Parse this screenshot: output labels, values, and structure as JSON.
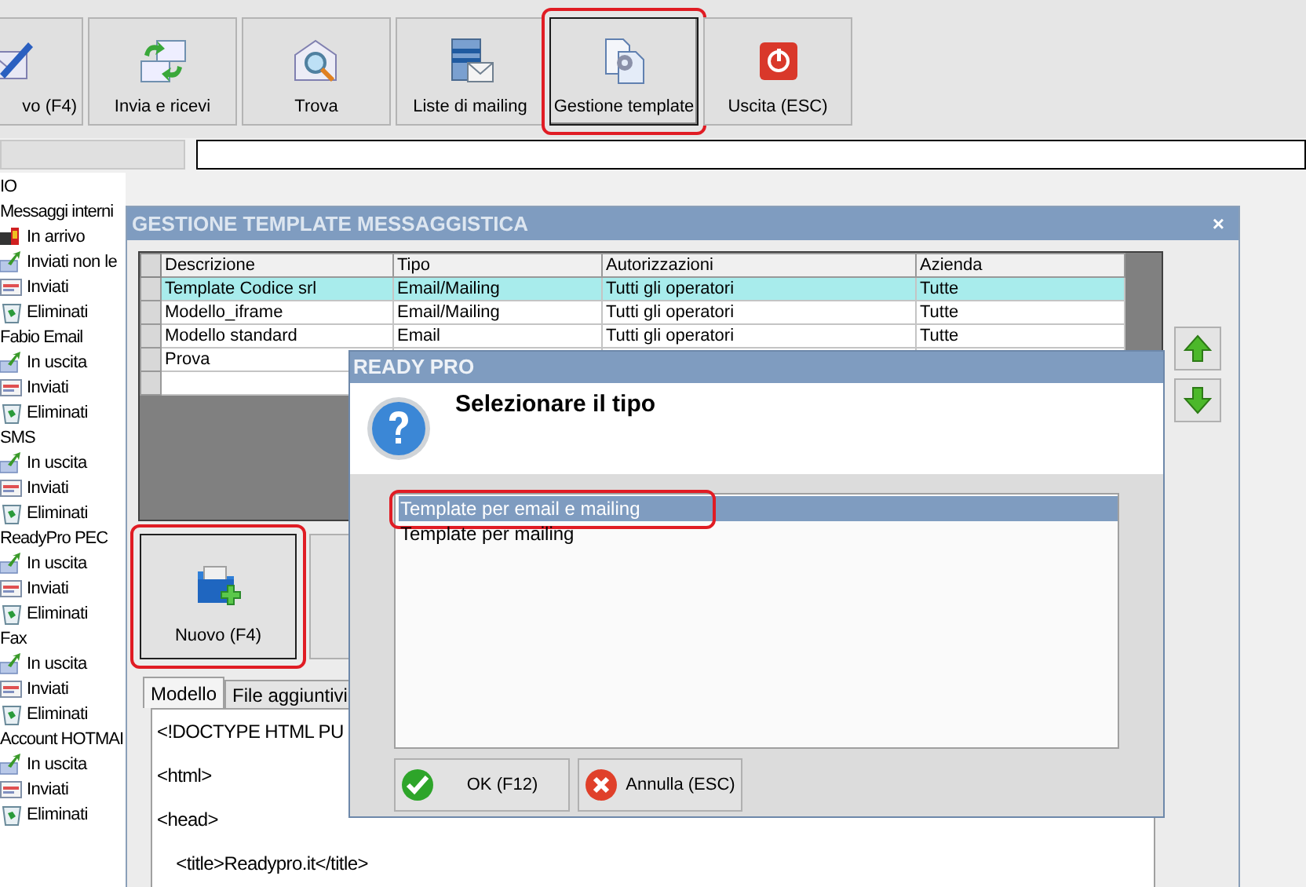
{
  "toolbar": [
    {
      "label": "vo (F4)",
      "kind": "new",
      "selected": false,
      "highlighted": false
    },
    {
      "label": "Invia e ricevi",
      "kind": "sendreceive",
      "selected": false,
      "highlighted": false
    },
    {
      "label": "Trova",
      "kind": "find",
      "selected": false,
      "highlighted": false
    },
    {
      "label": "Liste di mailing",
      "kind": "lists",
      "selected": false,
      "highlighted": false
    },
    {
      "label": "Gestione template",
      "kind": "templates",
      "selected": true,
      "highlighted": true
    },
    {
      "label": "Uscita (ESC)",
      "kind": "exit",
      "selected": false,
      "highlighted": false
    }
  ],
  "sidebar": {
    "items": [
      {
        "label": "IO"
      },
      {
        "label": "Messaggi interni",
        "children": [
          {
            "label": "In arrivo",
            "kind": "inbox"
          },
          {
            "label": "Inviati non le",
            "kind": "outbox"
          },
          {
            "label": "Inviati",
            "kind": "sent"
          },
          {
            "label": "Eliminati",
            "kind": "trash"
          }
        ]
      },
      {
        "label": "Fabio Email",
        "children": [
          {
            "label": "In uscita",
            "kind": "outbox"
          },
          {
            "label": "Inviati",
            "kind": "sent"
          },
          {
            "label": "Eliminati",
            "kind": "trash"
          }
        ]
      },
      {
        "label": "SMS",
        "children": [
          {
            "label": "In uscita",
            "kind": "outbox"
          },
          {
            "label": "Inviati",
            "kind": "sent"
          },
          {
            "label": "Eliminati",
            "kind": "trash"
          }
        ]
      },
      {
        "label": "ReadyPro PEC",
        "children": [
          {
            "label": "In uscita",
            "kind": "outbox"
          },
          {
            "label": "Inviati",
            "kind": "sent"
          },
          {
            "label": "Eliminati",
            "kind": "trash"
          }
        ]
      },
      {
        "label": "Fax",
        "children": [
          {
            "label": "In uscita",
            "kind": "outbox"
          },
          {
            "label": "Inviati",
            "kind": "sent"
          },
          {
            "label": "Eliminati",
            "kind": "trash"
          }
        ]
      },
      {
        "label": "Account HOTMAI",
        "children": [
          {
            "label": "In uscita",
            "kind": "outbox"
          },
          {
            "label": "Inviati",
            "kind": "sent"
          },
          {
            "label": "Eliminati",
            "kind": "trash"
          }
        ]
      }
    ]
  },
  "template_window": {
    "title": "GESTIONE TEMPLATE MESSAGGISTICA",
    "close": "×",
    "table": {
      "columns": [
        "Descrizione",
        "Tipo",
        "Autorizzazioni",
        "Azienda"
      ],
      "rows": [
        {
          "cells": [
            "Template Codice srl",
            "Email/Mailing",
            "Tutti gli operatori",
            "Tutte"
          ],
          "selected": true
        },
        {
          "cells": [
            "Modello_iframe",
            "Email/Mailing",
            "Tutti gli operatori",
            "Tutte"
          ],
          "selected": false
        },
        {
          "cells": [
            "Modello standard",
            "Email",
            "Tutti gli operatori",
            "Tutte"
          ],
          "selected": false
        },
        {
          "cells": [
            "Prova"
          ],
          "selected": false
        }
      ]
    },
    "new_button": {
      "label": "Nuovo (F4)",
      "highlighted": true
    },
    "tabs": [
      {
        "label": "Modello",
        "selected": true
      },
      {
        "label": "File aggiuntivi",
        "selected": false
      }
    ],
    "editor_lines": [
      "<!DOCTYPE HTML PU",
      "<html>",
      "<head>",
      "    <title>Readypro.it</title>"
    ]
  },
  "dialog": {
    "title": "READY PRO",
    "heading": "Selezionare il tipo",
    "options": [
      {
        "label": "Template per email e mailing",
        "selected": true,
        "highlighted": true
      },
      {
        "label": "Template per mailing",
        "selected": false,
        "highlighted": false
      }
    ],
    "buttons": [
      {
        "label": "OK (F12)",
        "kind": "ok"
      },
      {
        "label": "Annulla (ESC)",
        "kind": "cancel"
      }
    ]
  }
}
